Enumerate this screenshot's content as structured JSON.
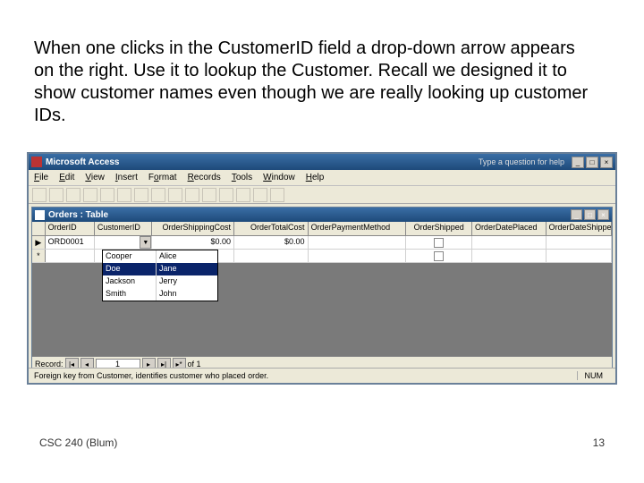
{
  "slide_text": "When one clicks in the CustomerID field a drop-down arrow appears on the right. Use it to lookup the Customer. Recall we designed it to show customer names even though we are really looking up customer IDs.",
  "app": {
    "title": "Microsoft Access",
    "help_hint": "Type a question for help"
  },
  "menu": {
    "file": "File",
    "edit": "Edit",
    "view": "View",
    "insert": "Insert",
    "format": "Format",
    "records": "Records",
    "tools": "Tools",
    "window": "Window",
    "help": "Help"
  },
  "doc": {
    "title": "Orders : Table"
  },
  "columns": {
    "orderid": "OrderID",
    "custid": "CustomerID",
    "ship": "OrderShippingCost",
    "total": "OrderTotalCost",
    "pay": "OrderPaymentMethod",
    "shipped": "OrderShipped",
    "dateplaced": "OrderDatePlaced",
    "dateshipped": "OrderDateShipped"
  },
  "row1": {
    "orderid": "ORD0001",
    "ship": "$0.00",
    "total": "$0.00"
  },
  "dropdown": [
    {
      "last": "Cooper",
      "first": "Alice"
    },
    {
      "last": "Doe",
      "first": "Jane"
    },
    {
      "last": "Jackson",
      "first": "Jerry"
    },
    {
      "last": "Smith",
      "first": "John"
    }
  ],
  "nav": {
    "label": "Record:",
    "current": "1",
    "of": "of 1"
  },
  "status": {
    "msg": "Foreign key from Customer, identifies customer who placed order.",
    "num": "NUM"
  },
  "footer": {
    "left": "CSC 240 (Blum)",
    "right": "13"
  }
}
